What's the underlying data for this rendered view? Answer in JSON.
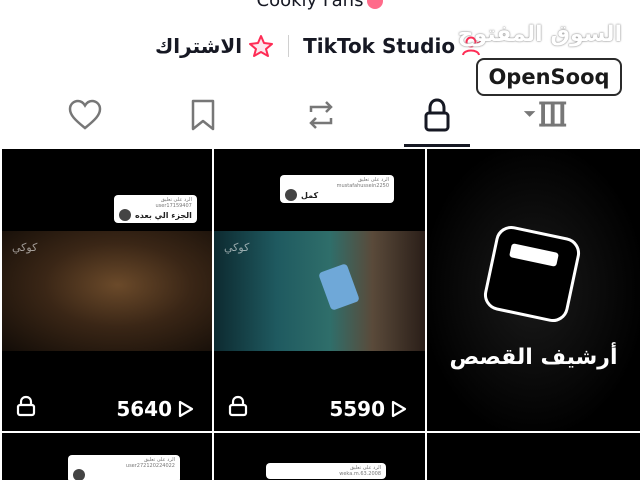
{
  "header": {
    "top_text": "Cookly Fans"
  },
  "actions": {
    "subscribe_label": "الاشتراك",
    "studio_label": "TikTok Studio"
  },
  "watermark": {
    "arabic": "السوق المفتوح",
    "brand": "OpenSooq"
  },
  "tabs": [
    {
      "icon": "heart-icon"
    },
    {
      "icon": "bookmark-icon"
    },
    {
      "icon": "repost-icon"
    },
    {
      "icon": "lock-icon",
      "active": true
    },
    {
      "icon": "grid-sort-icon"
    }
  ],
  "videos": [
    {
      "views": "5640",
      "reply_header": "الرد على تعليق",
      "reply_user": "user17159407",
      "reply_text": "الجزء الي بعده",
      "watermark": "كوكي"
    },
    {
      "views": "5590",
      "reply_header": "الرد على تعليق",
      "reply_user": "mustafahussein2250",
      "reply_text": "كمل",
      "watermark": "كوكي"
    },
    {
      "archive_label": "أرشيف القصص"
    },
    {
      "reply_header": "الرد على تعليق",
      "reply_user": "user272120224022"
    },
    {
      "reply_header": "الرد على تعليق",
      "reply_user": "weka.m.63.2008"
    }
  ],
  "colors": {
    "text": "#161823",
    "accent_pink": "#fe2c55",
    "tile_bg": "#000000"
  }
}
